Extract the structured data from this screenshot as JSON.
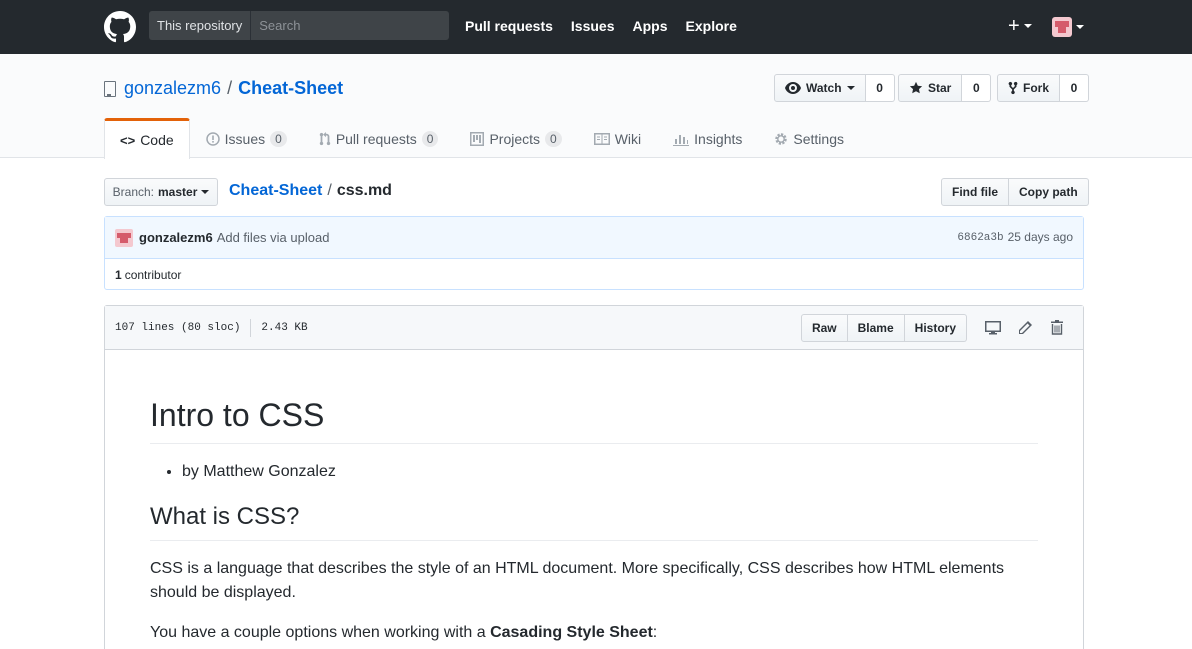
{
  "header": {
    "scope_label": "This repository",
    "search_placeholder": "Search",
    "nav": [
      "Pull requests",
      "Issues",
      "Apps",
      "Explore"
    ],
    "plus_symbol": "+"
  },
  "repo": {
    "owner": "gonzalezm6",
    "separator": "/",
    "name": "Cheat-Sheet",
    "watch_label": "Watch",
    "watch_count": "0",
    "star_label": "Star",
    "star_count": "0",
    "fork_label": "Fork",
    "fork_count": "0"
  },
  "reponav": {
    "code": "Code",
    "issues": "Issues",
    "issues_count": "0",
    "pulls": "Pull requests",
    "pulls_count": "0",
    "projects": "Projects",
    "projects_count": "0",
    "wiki": "Wiki",
    "insights": "Insights",
    "settings": "Settings"
  },
  "filenav": {
    "branch_label": "Branch:",
    "branch_value": "master",
    "crumb_repo": "Cheat-Sheet",
    "crumb_sep": "/",
    "crumb_file": "css.md",
    "find_file": "Find file",
    "copy_path": "Copy path"
  },
  "commit": {
    "author": "gonzalezm6",
    "message": "Add files via upload",
    "sha": "6862a3b",
    "time": "25 days ago",
    "contrib_count": "1",
    "contrib_label": "contributor"
  },
  "file": {
    "lines": "107 lines (80 sloc)",
    "size": "2.43 KB",
    "raw": "Raw",
    "blame": "Blame",
    "history": "History"
  },
  "markdown": {
    "h1": "Intro to CSS",
    "bullet": "by Matthew Gonzalez",
    "h2": "What is CSS?",
    "p1": "CSS is a language that describes the style of an HTML document. More specifically, CSS describes how HTML elements should be displayed.",
    "p2_prefix": "You have a couple options when working with a ",
    "p2_bold": "Casading Style Sheet",
    "p2_suffix": ":"
  },
  "colors": {
    "header_bg": "#24292e",
    "link": "#0366d6",
    "tab_accent": "#e36209",
    "commit_bg": "#f1f8ff"
  }
}
